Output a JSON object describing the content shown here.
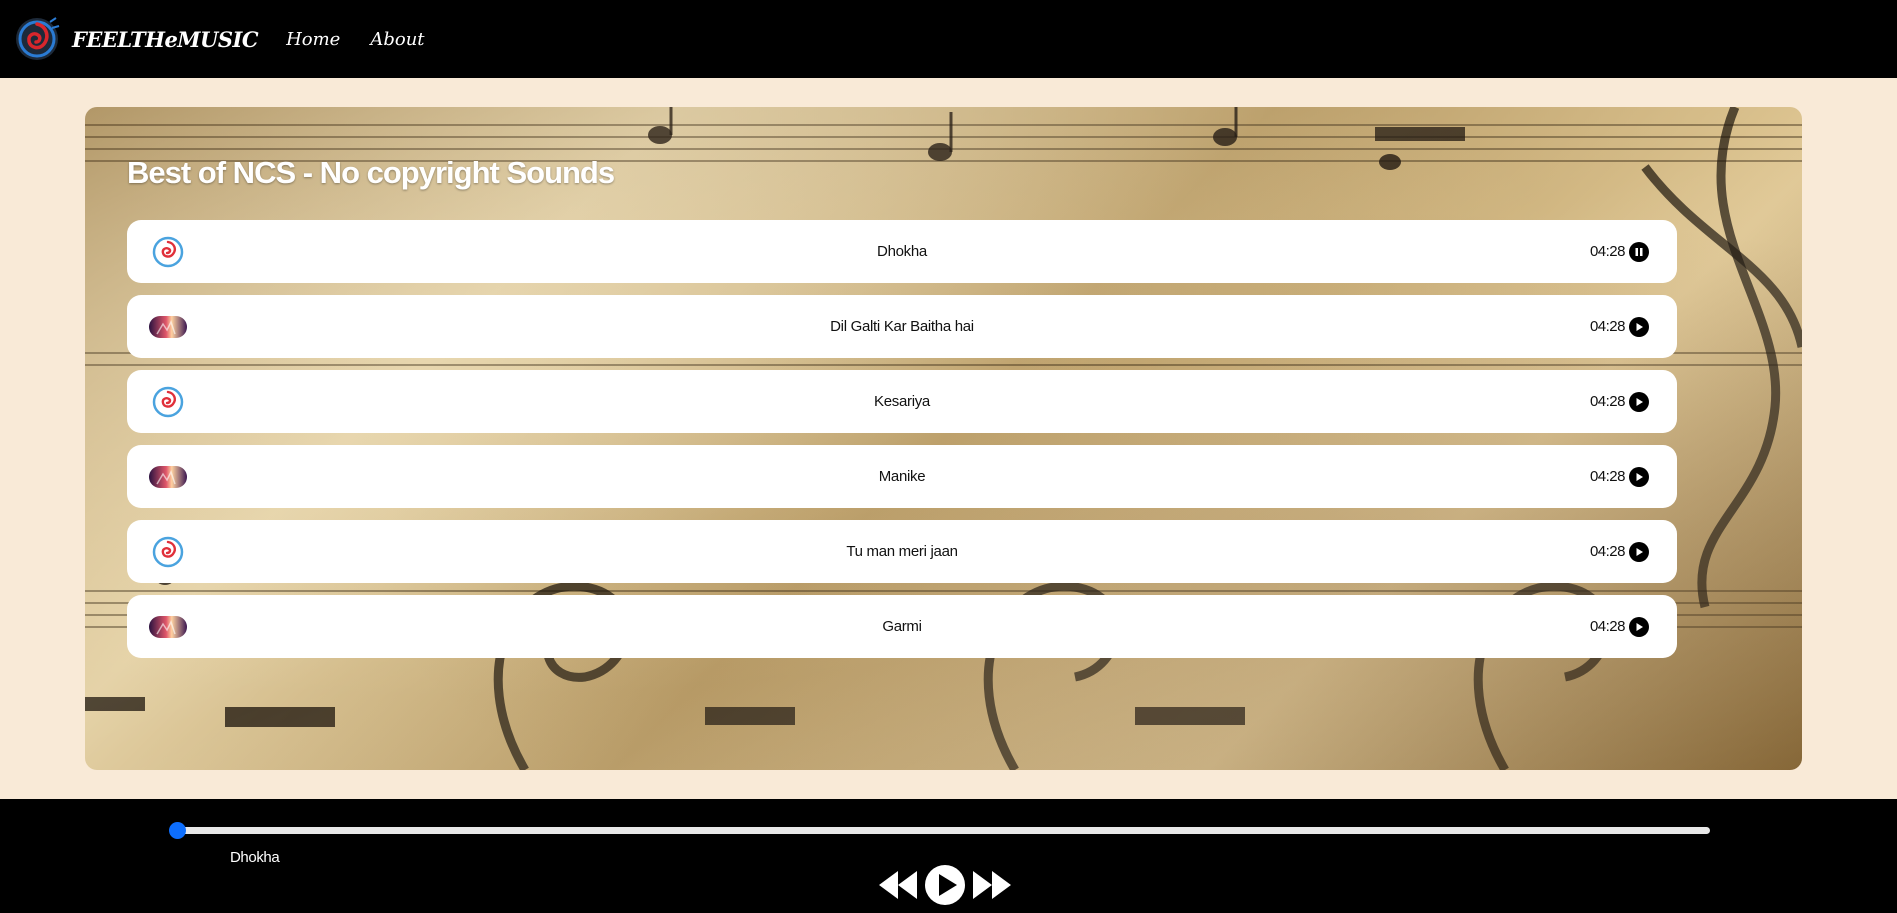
{
  "navbar": {
    "brand": "FEELTHeMUSIC",
    "links": [
      "Home",
      "About"
    ]
  },
  "playlist": {
    "title": "Best of NCS - No copyright Sounds",
    "songs": [
      {
        "name": "Dhokha",
        "duration": "04:28",
        "state": "pause",
        "thumb": "spiral-logo-thumb"
      },
      {
        "name": "Dil Galti Kar Baitha hai",
        "duration": "04:28",
        "state": "play",
        "thumb": "concert-thumb"
      },
      {
        "name": "Kesariya",
        "duration": "04:28",
        "state": "play",
        "thumb": "spiral-logo-thumb"
      },
      {
        "name": "Manike",
        "duration": "04:28",
        "state": "play",
        "thumb": "concert-thumb"
      },
      {
        "name": "Tu man meri jaan",
        "duration": "04:28",
        "state": "play",
        "thumb": "spiral-logo-thumb"
      },
      {
        "name": "Garmi",
        "duration": "04:28",
        "state": "play",
        "thumb": "concert-thumb"
      }
    ]
  },
  "player": {
    "now_playing": "Dhokha",
    "progress": 0,
    "controls": [
      "backward-icon",
      "play-icon",
      "forward-icon"
    ]
  },
  "colors": {
    "page_bg": "#f9ead7",
    "bar_bg": "#000000",
    "accent": "#0d6efd"
  }
}
